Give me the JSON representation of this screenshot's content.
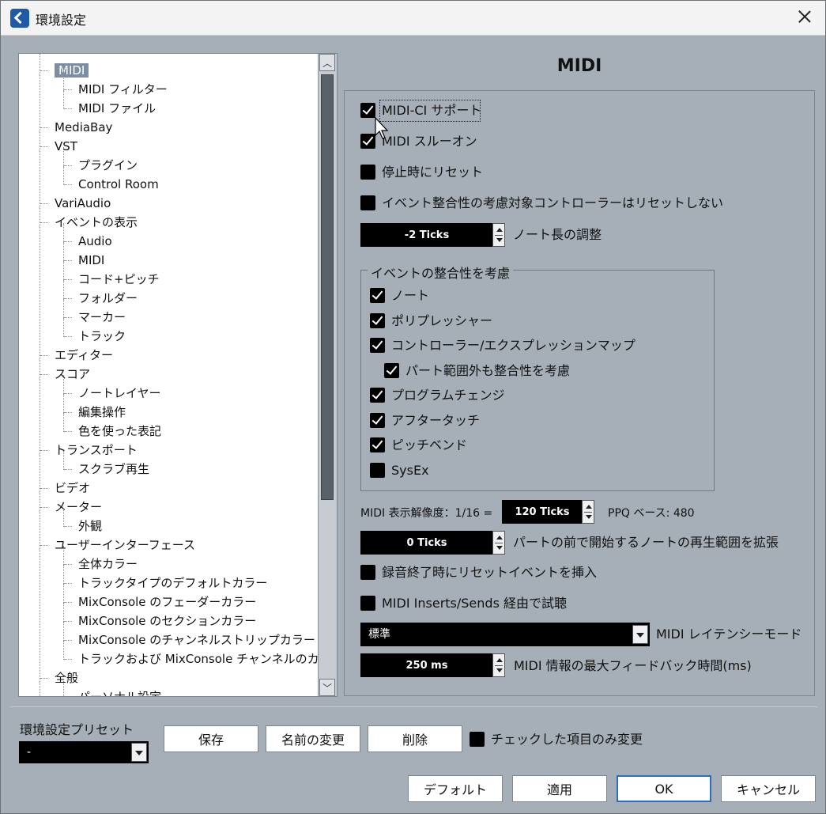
{
  "window": {
    "title": "環境設定"
  },
  "tree": {
    "items": [
      {
        "label": "MIDI",
        "level": 1,
        "selected": true
      },
      {
        "label": "MIDI フィルター",
        "level": 2
      },
      {
        "label": "MIDI ファイル",
        "level": 2
      },
      {
        "label": "MediaBay",
        "level": 1
      },
      {
        "label": "VST",
        "level": 1
      },
      {
        "label": "プラグイン",
        "level": 2
      },
      {
        "label": "Control Room",
        "level": 2
      },
      {
        "label": "VariAudio",
        "level": 1
      },
      {
        "label": "イベントの表示",
        "level": 1
      },
      {
        "label": "Audio",
        "level": 2
      },
      {
        "label": "MIDI",
        "level": 2
      },
      {
        "label": "コード+ピッチ",
        "level": 2
      },
      {
        "label": "フォルダー",
        "level": 2
      },
      {
        "label": "マーカー",
        "level": 2
      },
      {
        "label": "トラック",
        "level": 2
      },
      {
        "label": "エディター",
        "level": 1
      },
      {
        "label": "スコア",
        "level": 1
      },
      {
        "label": "ノートレイヤー",
        "level": 2
      },
      {
        "label": "編集操作",
        "level": 2
      },
      {
        "label": "色を使った表記",
        "level": 2
      },
      {
        "label": "トランスポート",
        "level": 1
      },
      {
        "label": "スクラブ再生",
        "level": 2
      },
      {
        "label": "ビデオ",
        "level": 1
      },
      {
        "label": "メーター",
        "level": 1
      },
      {
        "label": "外観",
        "level": 2
      },
      {
        "label": "ユーザーインターフェース",
        "level": 1
      },
      {
        "label": "全体カラー",
        "level": 2
      },
      {
        "label": "トラックタイプのデフォルトカラー",
        "level": 2
      },
      {
        "label": "MixConsole のフェーダーカラー",
        "level": 2
      },
      {
        "label": "MixConsole のセクションカラー",
        "level": 2
      },
      {
        "label": "MixConsole のチャンネルストリップカラー",
        "level": 2
      },
      {
        "label": "トラックおよび MixConsole チャンネルのカラー",
        "level": 2
      },
      {
        "label": "全般",
        "level": 1
      },
      {
        "label": "パーソナル設定",
        "level": 2
      }
    ]
  },
  "main": {
    "title": "MIDI",
    "midi_ci": {
      "label": "MIDI-CI サポート",
      "checked": true
    },
    "midi_thru": {
      "label": "MIDI スルーオン",
      "checked": true
    },
    "reset_on_stop": {
      "label": "停止時にリセット",
      "checked": false
    },
    "no_reset_chase": {
      "label": "イベント整合性の考慮対象コントローラーはリセットしない",
      "checked": false
    },
    "note_length": {
      "value": "-2 Ticks",
      "label": "ノート長の調整"
    },
    "chase_group": {
      "title": "イベントの整合性を考慮",
      "items": [
        {
          "label": "ノート",
          "checked": true
        },
        {
          "label": "ポリプレッシャー",
          "checked": true
        },
        {
          "label": "コントローラー/エクスプレッションマップ",
          "checked": true
        },
        {
          "label": "パート範囲外も整合性を考慮",
          "checked": true
        },
        {
          "label": "プログラムチェンジ",
          "checked": true
        },
        {
          "label": "アフタータッチ",
          "checked": true
        },
        {
          "label": "ピッチベンド",
          "checked": true
        },
        {
          "label": "SysEx",
          "checked": false
        }
      ]
    },
    "display_resolution": {
      "label": "MIDI 表示解像度：1/16 =",
      "value": "120 Ticks",
      "ppq": "PPQ ベース: 480"
    },
    "extend_note": {
      "value": "0 Ticks",
      "label": "パートの前で開始するノートの再生範囲を拡張"
    },
    "insert_reset": {
      "label": "録音終了時にリセットイベントを挿入",
      "checked": false
    },
    "audition_inserts": {
      "label": "MIDI Inserts/Sends 経由で試聴",
      "checked": false
    },
    "latency_mode": {
      "value": "標準",
      "label": "MIDI レイテンシーモード"
    },
    "max_feedback": {
      "value": "250 ms",
      "label": "MIDI 情報の最大フィードバック時間(ms)"
    }
  },
  "footer": {
    "preset_label": "環境設定プリセット",
    "preset_value": "-",
    "save": "保存",
    "rename": "名前の変更",
    "delete": "削除",
    "only_checked": {
      "label": "チェックした項目のみ変更",
      "checked": false
    },
    "default": "デフォルト",
    "apply": "適用",
    "ok": "OK",
    "cancel": "キャンセル"
  },
  "colors": {
    "panel": "#a6afb7",
    "selection": "#7d8ea3",
    "ok_border": "#2d6cc0"
  }
}
